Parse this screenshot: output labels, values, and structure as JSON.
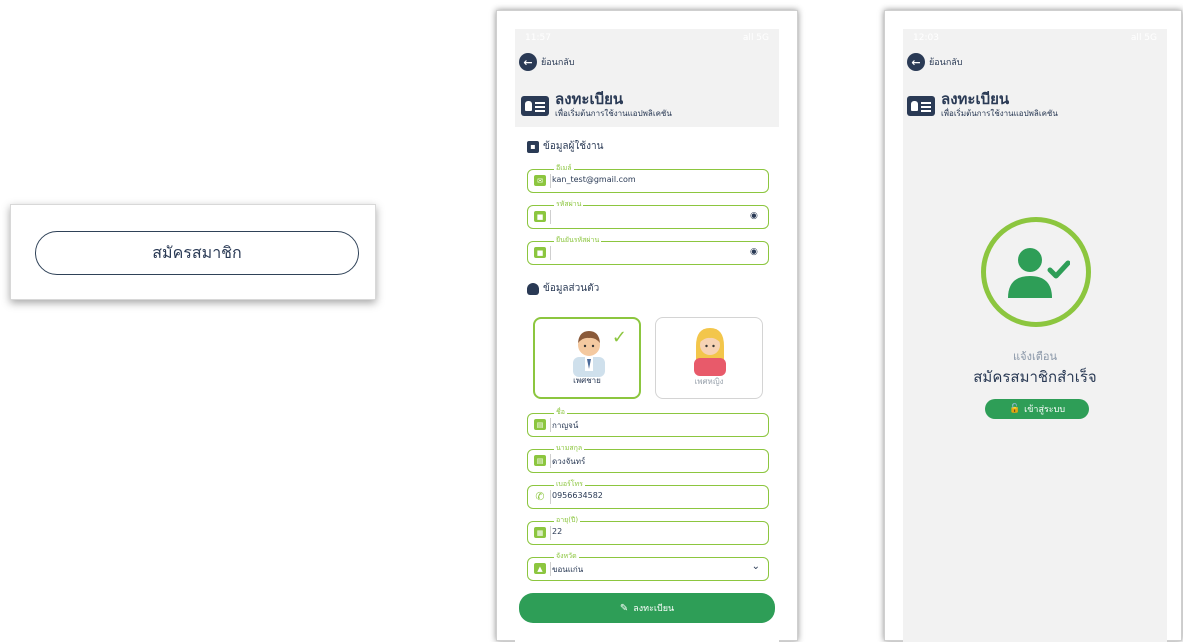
{
  "left_card": {
    "button_label": "สมัครสมาชิก"
  },
  "colors": {
    "navy": "#2a3a55",
    "green": "#2e9e57",
    "lime": "#8cc63f",
    "screen_bg": "#f2f2f2"
  },
  "phone1": {
    "status": {
      "time": "11:57",
      "signal": "all 5G"
    },
    "back_label": "ย้อนกลับ",
    "title": "ลงทะเบียน",
    "subtitle": "เพื่อเริ่มต้นการใช้งานแอปพลิเคชัน",
    "section_user": "ข้อมูลผู้ใช้งาน",
    "fields_user": [
      {
        "label": "อีเมล์",
        "value": "kan_test@gmail.com",
        "icon": "envelope-icon"
      },
      {
        "label": "รหัสผ่าน",
        "value": "",
        "icon": "lock-icon"
      },
      {
        "label": "ยืนยันรหัสผ่าน",
        "value": "",
        "icon": "lock-icon"
      }
    ],
    "section_personal": "ข้อมูลส่วนตัว",
    "genders": [
      {
        "label": "เพศชาย",
        "selected": true
      },
      {
        "label": "เพศหญิง",
        "selected": false
      }
    ],
    "fields_personal": [
      {
        "label": "ชื่อ",
        "value": "กาญจน์",
        "icon": "id-card-icon"
      },
      {
        "label": "นามสกุล",
        "value": "ดวงจันทร์",
        "icon": "id-card-icon"
      },
      {
        "label": "เบอร์โทร",
        "value": "0956634582",
        "icon": "phone-icon"
      },
      {
        "label": "อายุ(ปี)",
        "value": "22",
        "icon": "calendar-icon"
      },
      {
        "label": "จังหวัด",
        "value": "ขอนแก่น",
        "icon": "map-icon"
      }
    ],
    "submit_label": "ลงทะเบียน"
  },
  "phone2": {
    "status": {
      "time": "12:03",
      "signal": "all 5G"
    },
    "back_label": "ย้อนกลับ",
    "title": "ลงทะเบียน",
    "subtitle": "เพื่อเริ่มต้นการใช้งานแอปพลิเคชัน",
    "alert_title": "แจ้งเตือน",
    "alert_message": "สมัครสมาชิกสำเร็จ",
    "login_label": "เข้าสู่ระบบ"
  }
}
